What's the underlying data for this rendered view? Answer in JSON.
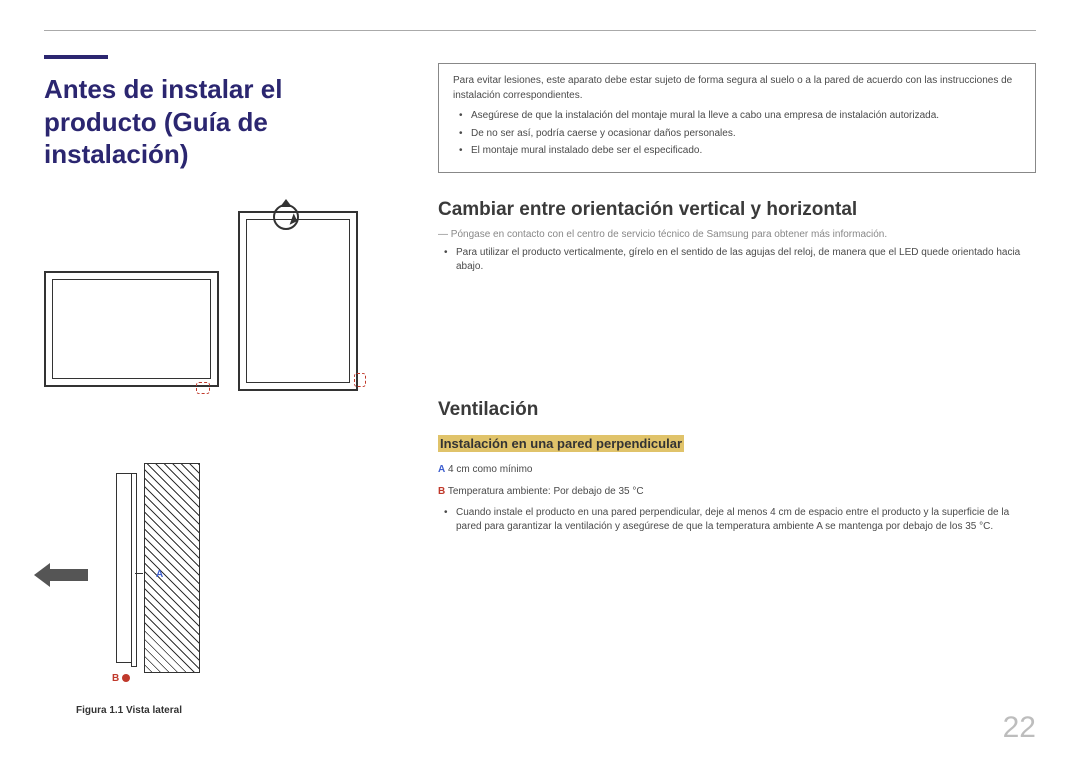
{
  "page_number": "22",
  "title": "Antes de instalar el producto (Guía de instalación)",
  "warning": {
    "intro": "Para evitar lesiones, este aparato debe estar sujeto de forma segura al suelo o a la pared de acuerdo con las instrucciones de instalación correspondientes.",
    "items": [
      "Asegúrese de que la instalación del montaje mural la lleve a cabo una empresa de instalación autorizada.",
      "De no ser así, podría caerse y ocasionar daños personales.",
      "El montaje mural instalado debe ser el especificado."
    ]
  },
  "section_orientation": {
    "heading": "Cambiar entre orientación vertical y horizontal",
    "note": "Póngase en contacto con el centro de servicio técnico de Samsung para obtener más información.",
    "bullet": "Para utilizar el producto verticalmente, gírelo en el sentido de las agujas del reloj, de manera que el LED quede orientado hacia abajo."
  },
  "section_ventilation": {
    "heading": "Ventilación",
    "subheading": "Instalación en una pared perpendicular",
    "legend_a_label": "A",
    "legend_a_text": " 4 cm como mínimo",
    "legend_b_label": "B",
    "legend_b_text": " Temperatura ambiente: Por debajo de 35 °C",
    "bullet": "Cuando instale el producto en una pared perpendicular, deje al menos 4 cm de espacio entre el producto y la superficie de la pared para garantizar la ventilación y asegúrese de que la temperatura ambiente A se mantenga por debajo de los 35 °C."
  },
  "figure": {
    "a_label": "A",
    "b_label": "B",
    "caption": "Figura 1.1 Vista lateral"
  }
}
